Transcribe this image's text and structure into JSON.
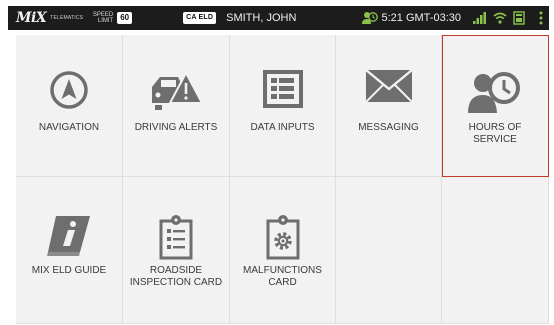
{
  "status_bar": {
    "brand_logo": "MiX",
    "brand_sub": "TELEMATICS",
    "speed_limit_label": "SPEED\nLIMIT",
    "speed_limit_value": "60",
    "eld_badge": "CA ELD",
    "driver_name": "SMITH, JOHN",
    "time": "5:21 GMT-03:30",
    "clock_icon_color": "#8bc34a",
    "signal_icon_color": "#8bc34a",
    "wifi_icon_color": "#8bc34a",
    "battery_icon_color": "#8bc34a"
  },
  "tiles": [
    {
      "label": "NAVIGATION",
      "icon": "navigation-icon"
    },
    {
      "label": "DRIVING ALERTS",
      "icon": "driving-alerts-icon"
    },
    {
      "label": "DATA INPUTS",
      "icon": "data-inputs-icon"
    },
    {
      "label": "MESSAGING",
      "icon": "messaging-icon"
    },
    {
      "label": "HOURS OF\nSERVICE",
      "icon": "hours-of-service-icon",
      "selected": true
    },
    {
      "label": "MIX ELD GUIDE",
      "icon": "eld-guide-icon"
    },
    {
      "label": "ROADSIDE\nINSPECTION CARD",
      "icon": "roadside-inspection-card-icon"
    },
    {
      "label": "MALFUNCTIONS\nCARD",
      "icon": "malfunctions-card-icon"
    }
  ],
  "colors": {
    "icon_gray": "#6e6e6e",
    "tile_bg": "#f2f2f2",
    "selected_border": "#c0392b",
    "status_bg": "#1c1c1c"
  }
}
